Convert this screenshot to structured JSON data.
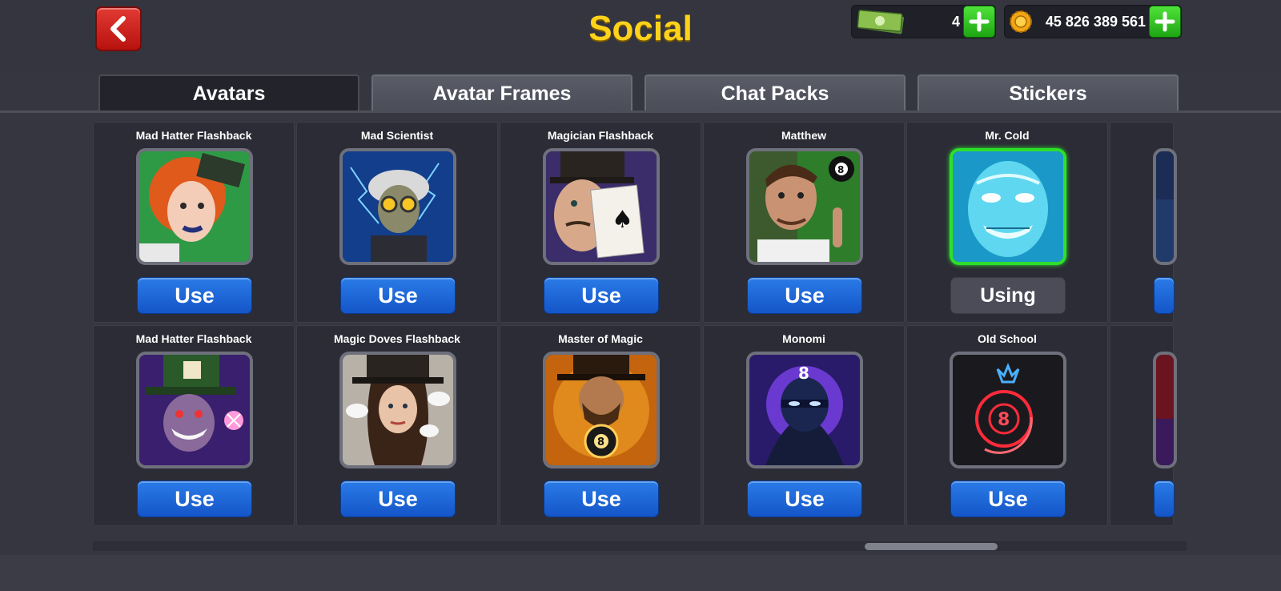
{
  "header": {
    "title": "Social",
    "cash": {
      "amount": "4"
    },
    "coins": {
      "amount": "45 826 389 561"
    }
  },
  "tabs": [
    {
      "label": "Avatars",
      "active": true
    },
    {
      "label": "Avatar Frames",
      "active": false
    },
    {
      "label": "Chat Packs",
      "active": false
    },
    {
      "label": "Stickers",
      "active": false
    }
  ],
  "avatars": [
    {
      "name": "Mad Hatter Flashback",
      "button": "Use"
    },
    {
      "name": "Mad Scientist",
      "button": "Use"
    },
    {
      "name": "Magician Flashback",
      "button": "Use"
    },
    {
      "name": "Matthew",
      "button": "Use"
    },
    {
      "name": "Mr. Cold",
      "button": "Using",
      "selected": true
    },
    {
      "name": "Mad Hatter Flashback",
      "button": "Use"
    },
    {
      "name": "Magic Doves Flashback",
      "button": "Use"
    },
    {
      "name": "Master of Magic",
      "button": "Use"
    },
    {
      "name": "Monomi",
      "button": "Use"
    },
    {
      "name": "Old School",
      "button": "Use"
    }
  ],
  "colors": {
    "title": "#ffd21a",
    "use_button": "#1f68d8",
    "selected_border": "#2ee02c",
    "back_button": "#d0221d"
  }
}
